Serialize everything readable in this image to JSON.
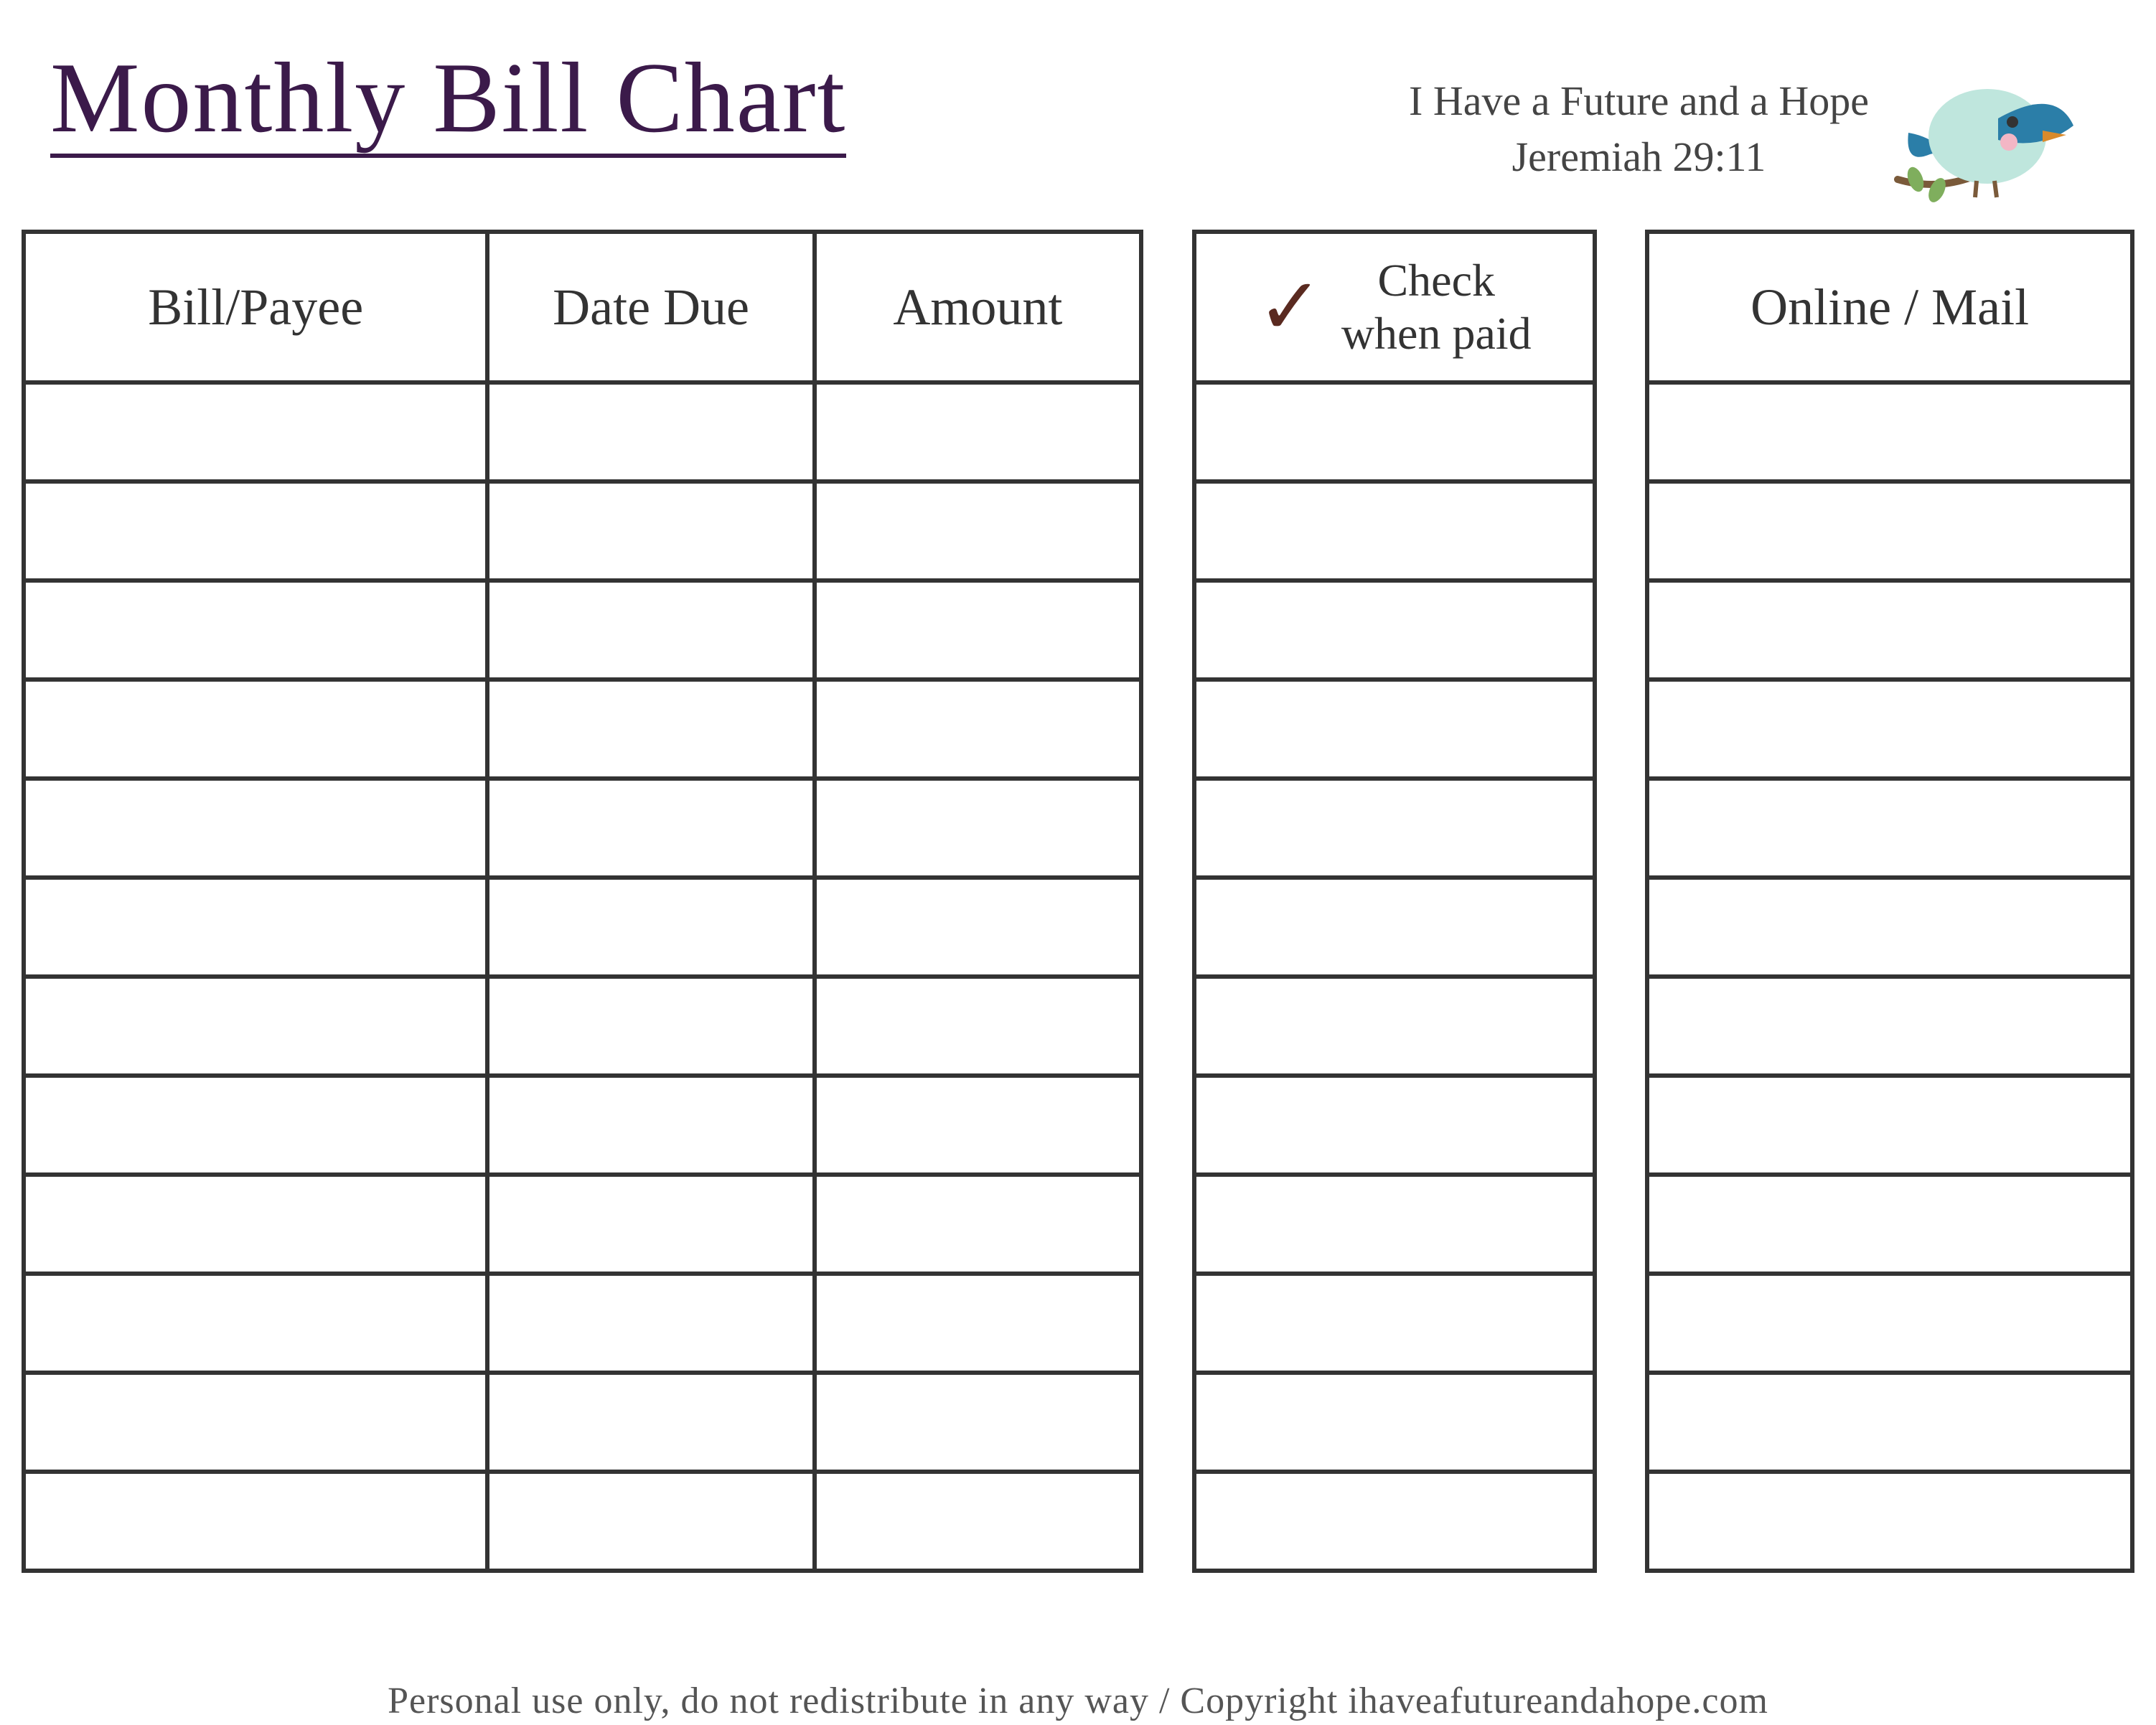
{
  "header": {
    "title": "Monthly Bill Chart",
    "scripture_line1": "I Have a Future and a Hope",
    "scripture_line2": "Jeremiah 29:11"
  },
  "columns": {
    "payee": "Bill/Payee",
    "date_due": "Date Due",
    "amount": "Amount",
    "check_line1": "Check",
    "check_line2": "when paid",
    "online_mail": "Online / Mail"
  },
  "rows": [
    {
      "payee": "",
      "date_due": "",
      "amount": "",
      "check": "",
      "online_mail": ""
    },
    {
      "payee": "",
      "date_due": "",
      "amount": "",
      "check": "",
      "online_mail": ""
    },
    {
      "payee": "",
      "date_due": "",
      "amount": "",
      "check": "",
      "online_mail": ""
    },
    {
      "payee": "",
      "date_due": "",
      "amount": "",
      "check": "",
      "online_mail": ""
    },
    {
      "payee": "",
      "date_due": "",
      "amount": "",
      "check": "",
      "online_mail": ""
    },
    {
      "payee": "",
      "date_due": "",
      "amount": "",
      "check": "",
      "online_mail": ""
    },
    {
      "payee": "",
      "date_due": "",
      "amount": "",
      "check": "",
      "online_mail": ""
    },
    {
      "payee": "",
      "date_due": "",
      "amount": "",
      "check": "",
      "online_mail": ""
    },
    {
      "payee": "",
      "date_due": "",
      "amount": "",
      "check": "",
      "online_mail": ""
    },
    {
      "payee": "",
      "date_due": "",
      "amount": "",
      "check": "",
      "online_mail": ""
    },
    {
      "payee": "",
      "date_due": "",
      "amount": "",
      "check": "",
      "online_mail": ""
    },
    {
      "payee": "",
      "date_due": "",
      "amount": "",
      "check": "",
      "online_mail": ""
    }
  ],
  "footer": "Personal use only, do not redistribute in any way / Copyright ihaveafutureandahope.com",
  "chart_data": {
    "type": "table",
    "title": "Monthly Bill Chart",
    "columns": [
      "Bill/Payee",
      "Date Due",
      "Amount",
      "Check when paid",
      "Online / Mail"
    ],
    "rows": [
      [
        "",
        "",
        "",
        "",
        ""
      ],
      [
        "",
        "",
        "",
        "",
        ""
      ],
      [
        "",
        "",
        "",
        "",
        ""
      ],
      [
        "",
        "",
        "",
        "",
        ""
      ],
      [
        "",
        "",
        "",
        "",
        ""
      ],
      [
        "",
        "",
        "",
        "",
        ""
      ],
      [
        "",
        "",
        "",
        "",
        ""
      ],
      [
        "",
        "",
        "",
        "",
        ""
      ],
      [
        "",
        "",
        "",
        "",
        ""
      ],
      [
        "",
        "",
        "",
        "",
        ""
      ],
      [
        "",
        "",
        "",
        "",
        ""
      ],
      [
        "",
        "",
        "",
        "",
        ""
      ]
    ]
  }
}
